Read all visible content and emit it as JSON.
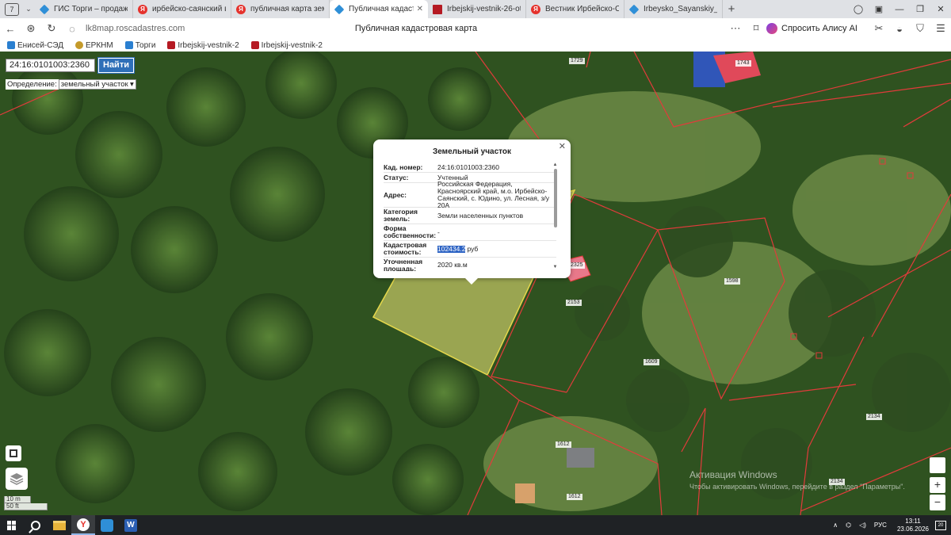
{
  "browser": {
    "tab_count": "7",
    "tabs": [
      {
        "label": "ГИС Торги – продажи гос",
        "favicon": "gis-torgi-icon",
        "active": false
      },
      {
        "label": "ирбейско-саянский вест",
        "favicon": "yandex-icon",
        "active": false
      },
      {
        "label": "публичная карта земел",
        "favicon": "yandex-icon",
        "active": false
      },
      {
        "label": "Публичная кадастрова",
        "favicon": "pkk-icon",
        "active": true
      },
      {
        "label": "Irbejskij-vestnik-26-ot-26.0",
        "favicon": "document-icon",
        "active": false
      },
      {
        "label": "Вестник Ирбейско-Саянс",
        "favicon": "yandex-icon",
        "active": false
      },
      {
        "label": "Irbeysko_Sayanskiy_vestn",
        "favicon": "web-icon",
        "active": false
      }
    ],
    "url": "lk8map.roscadastres.com",
    "page_title": "Публичная кадастровая карта",
    "alice_label": "Спросить Алису AI",
    "bookmarks": [
      {
        "label": "Енисей-СЭД",
        "icon": "enisey-icon"
      },
      {
        "label": "ЕРКНМ",
        "icon": "erknm-icon"
      },
      {
        "label": "Торги",
        "icon": "torgi-icon"
      },
      {
        "label": "Irbejskij-vestnik-2",
        "icon": "document-icon"
      },
      {
        "label": "Irbejskij-vestnik-2",
        "icon": "document-icon"
      }
    ]
  },
  "map": {
    "search_value": "24:16:0101003:2360",
    "find_label": "Найти",
    "definition_label": "Определение:",
    "definition_value": "земельный участок",
    "plot_labels": [
      "1729",
      "1743",
      "2325",
      "2153",
      "1598",
      "1609",
      "1612",
      "1612",
      "2134",
      "2134"
    ],
    "scale_labels": [
      "10 m",
      "50 ft"
    ],
    "zoom_in": "+",
    "zoom_out": "−",
    "colors": {
      "highlight_fill": "#f2e97a",
      "boundary": "#e23b3b",
      "selected_text_bg": "#2e64c4"
    }
  },
  "popup": {
    "title": "Земельный участок",
    "rows": [
      {
        "key": "Кад. номер:",
        "value": "24:16:0101003:2360"
      },
      {
        "key": "Статус:",
        "value": "Учтенный"
      },
      {
        "key": "Адрес:",
        "value": "Российская Федерация, Красноярский край, м.о. Ирбейско-Саянский, с. Юдино, ул. Лесная, з/у 20А"
      },
      {
        "key": "Категория земель:",
        "value": "Земли населенных пунктов"
      },
      {
        "key": "Форма собственности:",
        "value": "-"
      },
      {
        "key": "Кадастровая стоимость:",
        "value_selected": "102434.2",
        "value_unit": "руб"
      },
      {
        "key": "Уточненная площадь:",
        "value": "2020 кв.м"
      }
    ]
  },
  "watermark": {
    "title": "Активация Windows",
    "subtitle": "Чтобы активировать Windows, перейдите в раздел \"Параметры\"."
  },
  "taskbar": {
    "tray_language": "РУС",
    "time": "13:11",
    "date": "23.06.2026",
    "notifications": "20"
  }
}
